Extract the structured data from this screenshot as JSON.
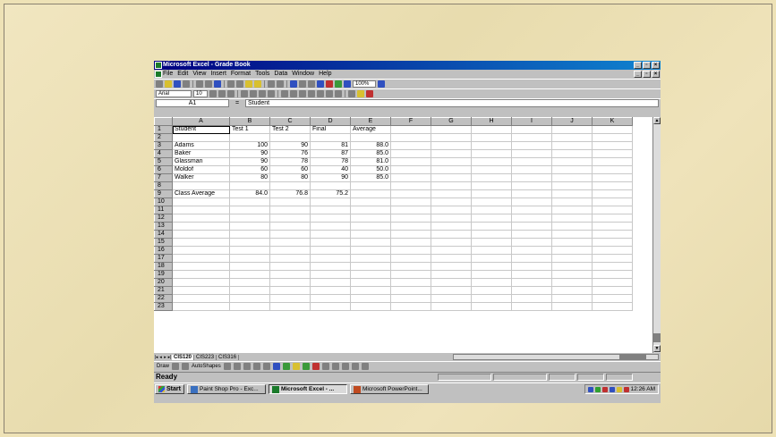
{
  "window": {
    "title": "Microsoft Excel - Grade Book"
  },
  "menu": [
    "File",
    "Edit",
    "View",
    "Insert",
    "Format",
    "Tools",
    "Data",
    "Window",
    "Help"
  ],
  "toolbar": {
    "zoom": "100%",
    "font_name": "Arial",
    "font_size": "10"
  },
  "formula_bar": {
    "name_box": "A1",
    "equals": "=",
    "content": "Student"
  },
  "sheet": {
    "columns": [
      "A",
      "B",
      "C",
      "D",
      "E",
      "F",
      "G",
      "H",
      "I",
      "J",
      "K"
    ],
    "rows": [
      {
        "n": "1",
        "cells": [
          "Student",
          "Test 1",
          "Test 2",
          "Final",
          "Average"
        ]
      },
      {
        "n": "2",
        "cells": [
          "",
          "",
          "",
          "",
          ""
        ]
      },
      {
        "n": "3",
        "cells": [
          "Adams",
          "100",
          "90",
          "81",
          "88.0"
        ]
      },
      {
        "n": "4",
        "cells": [
          "Baker",
          "90",
          "76",
          "87",
          "85.0"
        ]
      },
      {
        "n": "5",
        "cells": [
          "Glassman",
          "90",
          "78",
          "78",
          "81.0"
        ]
      },
      {
        "n": "6",
        "cells": [
          "Moldof",
          "60",
          "60",
          "40",
          "50.0"
        ]
      },
      {
        "n": "7",
        "cells": [
          "Walker",
          "80",
          "80",
          "90",
          "85.0"
        ]
      },
      {
        "n": "8",
        "cells": [
          "",
          "",
          "",
          "",
          ""
        ]
      },
      {
        "n": "9",
        "cells": [
          "Class Average",
          "84.0",
          "76.8",
          "75.2",
          ""
        ]
      },
      {
        "n": "10",
        "cells": [
          "",
          "",
          "",
          "",
          ""
        ]
      },
      {
        "n": "11",
        "cells": [
          "",
          "",
          "",
          "",
          ""
        ]
      },
      {
        "n": "12",
        "cells": [
          "",
          "",
          "",
          "",
          ""
        ]
      },
      {
        "n": "13",
        "cells": [
          "",
          "",
          "",
          "",
          ""
        ]
      },
      {
        "n": "14",
        "cells": [
          "",
          "",
          "",
          "",
          ""
        ]
      },
      {
        "n": "15",
        "cells": [
          "",
          "",
          "",
          "",
          ""
        ]
      },
      {
        "n": "16",
        "cells": [
          "",
          "",
          "",
          "",
          ""
        ]
      },
      {
        "n": "17",
        "cells": [
          "",
          "",
          "",
          "",
          ""
        ]
      },
      {
        "n": "18",
        "cells": [
          "",
          "",
          "",
          "",
          ""
        ]
      },
      {
        "n": "19",
        "cells": [
          "",
          "",
          "",
          "",
          ""
        ]
      },
      {
        "n": "20",
        "cells": [
          "",
          "",
          "",
          "",
          ""
        ]
      },
      {
        "n": "21",
        "cells": [
          "",
          "",
          "",
          "",
          ""
        ]
      },
      {
        "n": "22",
        "cells": [
          "",
          "",
          "",
          "",
          ""
        ]
      },
      {
        "n": "23",
        "cells": [
          "",
          "",
          "",
          "",
          ""
        ]
      }
    ]
  },
  "sheet_tabs": [
    "CIS120",
    "CIS223",
    "CIS316"
  ],
  "draw_toolbar": {
    "draw_label": "Draw",
    "autoshapes_label": "AutoShapes"
  },
  "status": {
    "text": "Ready"
  },
  "taskbar": {
    "start": "Start",
    "tasks": [
      "Paint Shop Pro - Exc...",
      "Microsoft Excel - ...",
      "Microsoft PowerPoint..."
    ],
    "clock": "12:26 AM"
  }
}
